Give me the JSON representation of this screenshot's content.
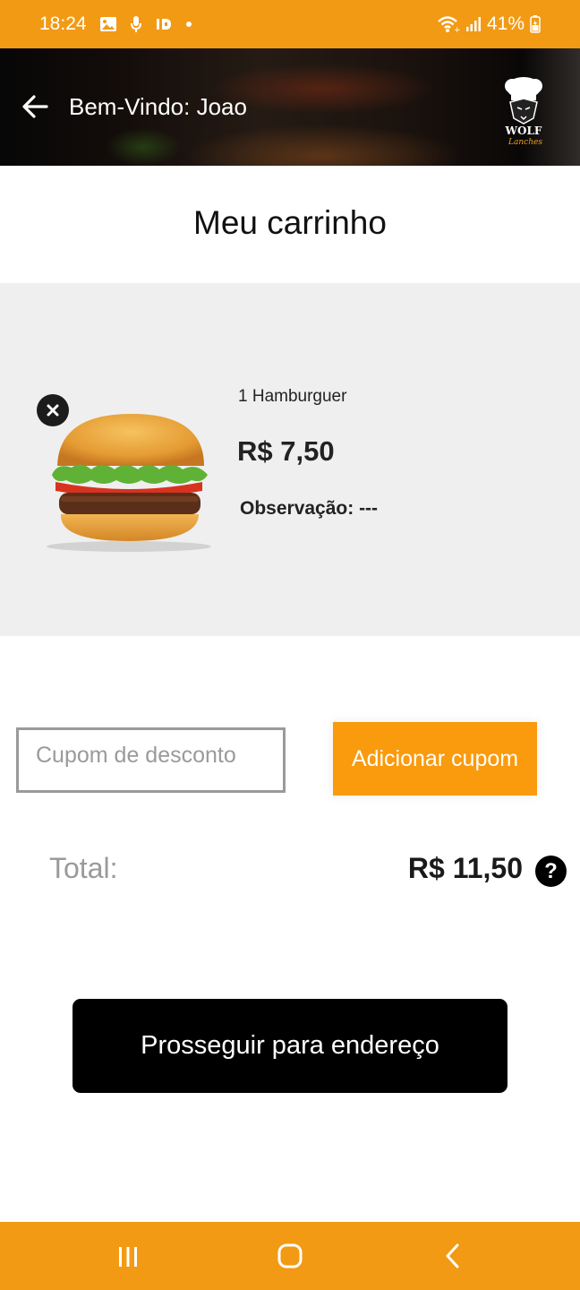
{
  "status_bar": {
    "time": "18:24",
    "battery": "41%",
    "icons": [
      "gallery-icon",
      "mic-icon",
      "id-icon",
      "dot-icon",
      "wifi-icon",
      "signal-icon",
      "battery-icon"
    ]
  },
  "header": {
    "greeting": "Bem-Vindo: Joao",
    "logo_text": "WOLF",
    "logo_subtext": "Lanches"
  },
  "page_title": "Meu carrinho",
  "cart": {
    "items": [
      {
        "name": "1 Hamburguer",
        "price": "R$ 7,50",
        "observation": "Observação: ---"
      }
    ]
  },
  "coupon": {
    "placeholder": "Cupom de desconto",
    "value": "",
    "button_label": "Adicionar cupom"
  },
  "total": {
    "label": "Total:",
    "value": "R$ 11,50",
    "help_icon": "?"
  },
  "proceed_button": "Prosseguir para endereço",
  "colors": {
    "status_bar": "#f29a14",
    "accent": "#fa9a0d",
    "cart_bg": "#efefef",
    "proceed_bg": "#000000"
  }
}
